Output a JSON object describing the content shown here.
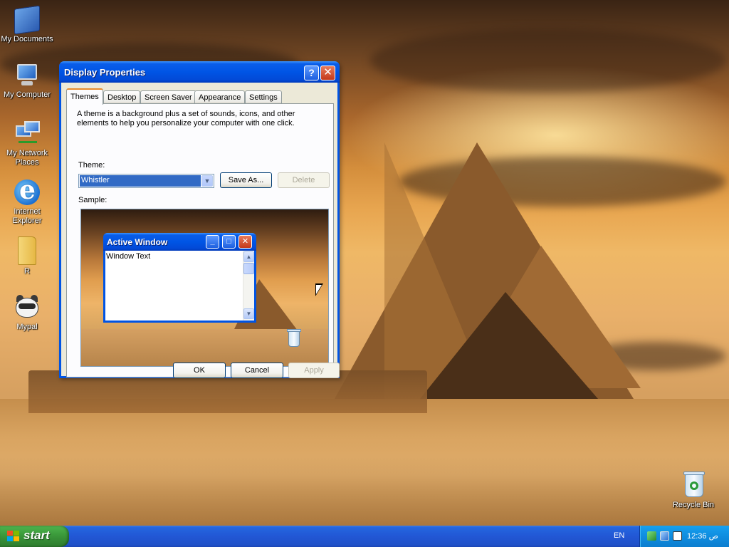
{
  "desktop": {
    "icons": [
      {
        "label": "My Documents",
        "icon": "my-documents-icon"
      },
      {
        "label": "My Computer",
        "icon": "my-computer-icon"
      },
      {
        "label": "My Network Places",
        "icon": "network-places-icon"
      },
      {
        "label": "Internet Explorer",
        "icon": "internet-explorer-icon"
      },
      {
        "label": "R",
        "icon": "folder-icon"
      },
      {
        "label": "Mypal",
        "icon": "mypal-browser-icon"
      },
      {
        "label": "Recycle Bin",
        "icon": "recycle-bin-icon"
      }
    ]
  },
  "dialog": {
    "title": "Display Properties",
    "help_glyph": "?",
    "close_glyph": "✕",
    "tabs": [
      "Themes",
      "Desktop",
      "Screen Saver",
      "Appearance",
      "Settings"
    ],
    "active_tab": "Themes",
    "description": "A theme is a background plus a set of sounds, icons, and other elements to help you personalize your computer with one click.",
    "theme_label": "Theme:",
    "theme_value": "Whistler",
    "save_as_label": "Save As...",
    "delete_label": "Delete",
    "sample_label": "Sample:",
    "sample": {
      "active_window_title": "Active Window",
      "window_text": "Window Text"
    },
    "ok_label": "OK",
    "cancel_label": "Cancel",
    "apply_label": "Apply"
  },
  "taskbar": {
    "start_label": "start",
    "language": "EN",
    "clock": "12:36 ص"
  },
  "colors": {
    "titlebar": "#0054e3",
    "taskbar": "#245edb",
    "start_button": "#3c9c3c",
    "tray": "#0f8de0",
    "dialog_face": "#ece9d8"
  }
}
